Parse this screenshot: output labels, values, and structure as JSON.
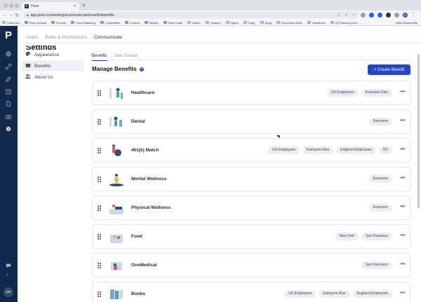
{
  "browser": {
    "tab_title": "Pave",
    "tab_favicon": "P",
    "url": "app.pave.com/settings/communicate/benefits/benefits",
    "bookmarks": [
      "Pave.com",
      "Pave General",
      "Product",
      "Pave Marketing",
      "Competitive",
      "Content",
      "Metrics",
      "Pave Email",
      "Notion",
      "Hubspot",
      "Figma",
      "Gong",
      "Sprig",
      "Pave Asset Bible",
      "Salesforce",
      "Q3 Planning Hom..."
    ],
    "other_bookmarks": "Other Bookmarks",
    "profile_initial": "G"
  },
  "rail": {
    "logo": "P",
    "icons": [
      "globe-icon",
      "link-icon",
      "pencil-icon",
      "people-icon",
      "document-icon",
      "gift-icon",
      "gear-icon"
    ],
    "chat_icon": "chat-icon",
    "expand": "›",
    "avatar": "DR"
  },
  "page": {
    "title": "Settings",
    "tabs": [
      "Users",
      "Roles & Permissions",
      "Communicate"
    ],
    "active_tab": "Communicate"
  },
  "side_nav": [
    {
      "label": "Appearance",
      "icon": "palette-icon"
    },
    {
      "label": "Benefits",
      "icon": "gift-icon"
    },
    {
      "label": "About Us",
      "icon": "people-icon"
    }
  ],
  "content": {
    "sub_tabs": [
      "Benefits",
      "User Groups"
    ],
    "heading": "Manage Benefits",
    "create_button": "+ Create Benefit"
  },
  "benefits": [
    {
      "name": "Healthcare",
      "groups": [
        "US Employees",
        "Everyone Else"
      ]
    },
    {
      "name": "Dental",
      "groups": [
        "Everyone"
      ]
    },
    {
      "name": "401(k) Match",
      "groups": [
        "US Employees",
        "Everyone Else",
        "England Employees",
        "DC"
      ]
    },
    {
      "name": "Mental Wellness",
      "groups": [
        "Everyone"
      ]
    },
    {
      "name": "Physical Wellness",
      "groups": [
        "Everyone"
      ]
    },
    {
      "name": "Food",
      "groups": [
        "New York",
        "San Francisco"
      ]
    },
    {
      "name": "OneMedical",
      "groups": [
        "San Francisco"
      ]
    },
    {
      "name": "Books",
      "groups": [
        "US Employees",
        "Everyone Else",
        "England Employees"
      ]
    }
  ],
  "colors": {
    "rail": "#13294b",
    "accent": "#2346c7",
    "chip": "#eceef2"
  }
}
